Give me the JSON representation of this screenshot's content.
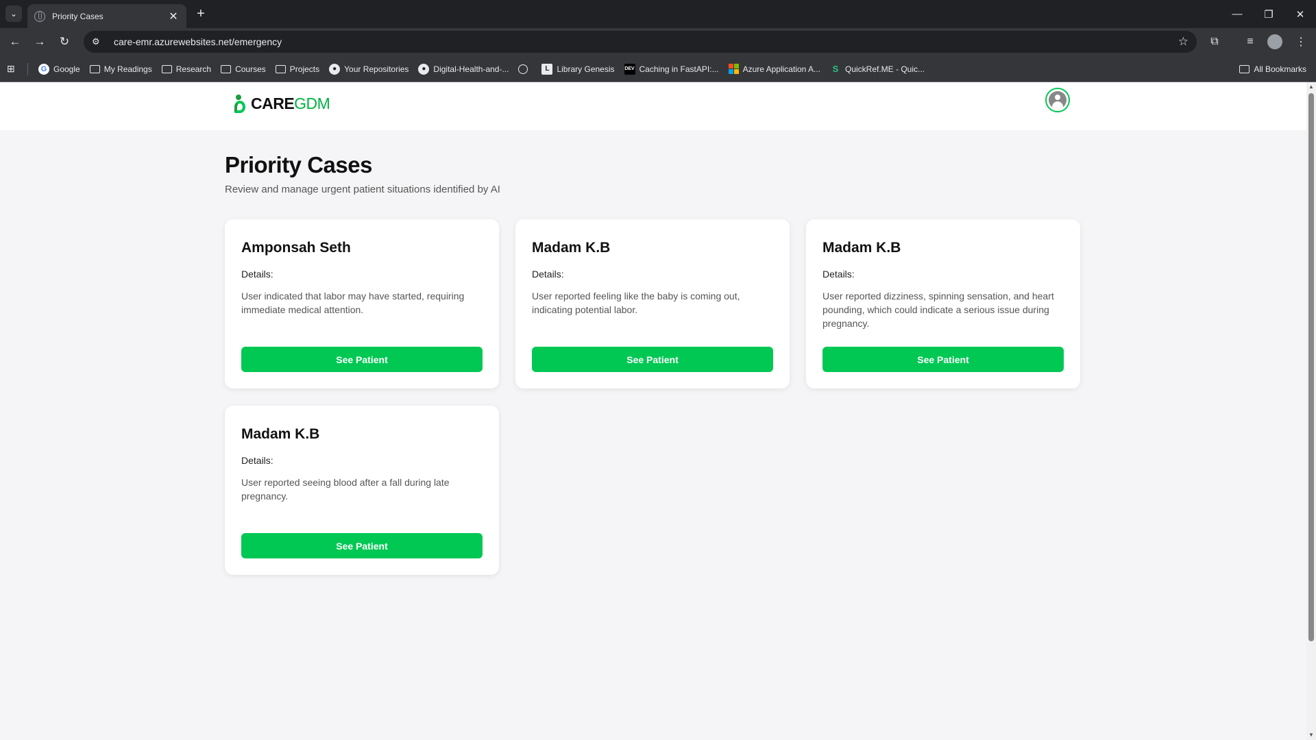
{
  "browser": {
    "tab_title": "Priority Cases",
    "url": "care-emr.azurewebsites.net/emergency",
    "bookmarks": [
      {
        "label": "Google",
        "icon": "google-icon"
      },
      {
        "label": "My Readings",
        "icon": "folder-icon"
      },
      {
        "label": "Research",
        "icon": "folder-icon"
      },
      {
        "label": "Courses",
        "icon": "folder-icon"
      },
      {
        "label": "Projects",
        "icon": "folder-icon"
      },
      {
        "label": "Your Repositories",
        "icon": "github-icon"
      },
      {
        "label": "Digital-Health-and-...",
        "icon": "github-icon"
      },
      {
        "label": "",
        "icon": "globe-icon"
      },
      {
        "label": "Library Genesis",
        "icon": "library-icon"
      },
      {
        "label": "Caching in FastAPI:...",
        "icon": "dev-icon"
      },
      {
        "label": "Azure Application A...",
        "icon": "microsoft-icon"
      },
      {
        "label": "QuickRef.ME - Quic...",
        "icon": "quickref-icon"
      }
    ],
    "all_bookmarks": "All Bookmarks"
  },
  "app": {
    "logo_care": "CARE",
    "logo_gdm": "GDM",
    "brand_color": "#00c853"
  },
  "page": {
    "title": "Priority Cases",
    "subtitle": "Review and manage urgent patient situations identified by AI"
  },
  "cases": [
    {
      "name": "Amponsah Seth",
      "details_label": "Details:",
      "details": "User indicated that labor may have started, requiring immediate medical attention.",
      "button": "See Patient"
    },
    {
      "name": "Madam K.B",
      "details_label": "Details:",
      "details": "User reported feeling like the baby is coming out, indicating potential labor.",
      "button": "See Patient"
    },
    {
      "name": "Madam K.B",
      "details_label": "Details:",
      "details": "User reported dizziness, spinning sensation, and heart pounding, which could indicate a serious issue during pregnancy.",
      "button": "See Patient"
    },
    {
      "name": "Madam K.B",
      "details_label": "Details:",
      "details": "User reported seeing blood after a fall during late pregnancy.",
      "button": "See Patient"
    }
  ]
}
